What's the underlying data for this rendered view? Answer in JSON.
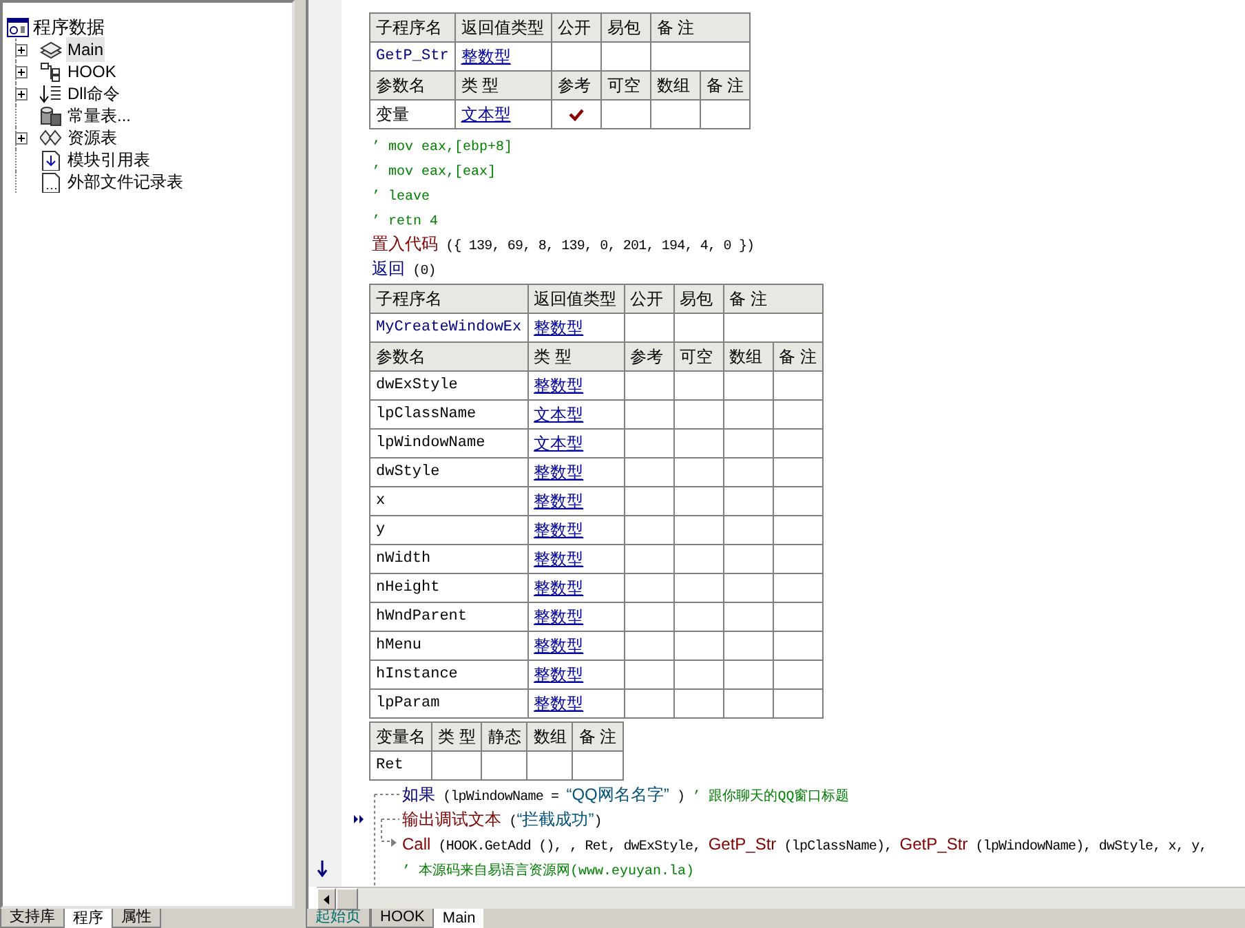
{
  "tree": {
    "label": "程序数据",
    "children": [
      {
        "label": "Main",
        "expandable": true,
        "selected": true
      },
      {
        "label": "HOOK",
        "expandable": true,
        "selected": false
      },
      {
        "label": "Dll命令",
        "expandable": true,
        "selected": false
      },
      {
        "label": "常量表...",
        "expandable": false,
        "selected": false
      },
      {
        "label": "资源表",
        "expandable": true,
        "selected": false
      },
      {
        "label": "模块引用表",
        "expandable": false,
        "selected": false
      },
      {
        "label": "外部文件记录表",
        "expandable": false,
        "selected": false
      }
    ]
  },
  "left_tabs": [
    {
      "label": "支持库",
      "selected": false
    },
    {
      "label": "程序",
      "selected": true
    },
    {
      "label": "属性",
      "selected": false
    }
  ],
  "blocks": [
    {
      "kind": "sub",
      "header": [
        "子程序名",
        "返回值类型",
        "公开",
        "易包",
        "备 注"
      ],
      "name": "GetP_Str",
      "return_type": "整数型",
      "param_header": [
        "参数名",
        "类 型",
        "参考",
        "可空",
        "数组",
        "备 注"
      ],
      "params": [
        {
          "name": "变量",
          "type": "文本型",
          "reference": true
        }
      ]
    },
    {
      "kind": "code",
      "segments": [
        {
          "kind": "comment",
          "text": "’ mov eax,[ebp+8]"
        }
      ]
    },
    {
      "kind": "code",
      "segments": [
        {
          "kind": "comment",
          "text": "’ mov eax,[eax]"
        }
      ]
    },
    {
      "kind": "code",
      "segments": [
        {
          "kind": "comment",
          "text": "’ leave"
        }
      ]
    },
    {
      "kind": "code",
      "segments": [
        {
          "kind": "comment",
          "text": "’ retn 4"
        }
      ]
    },
    {
      "kind": "code",
      "segments": [
        {
          "kind": "cmd",
          "text": "置入代码"
        },
        {
          "kind": "plain",
          "text": " ({ 139, 69, 8, 139, 0, 201, 194, 4, 0 })"
        }
      ]
    },
    {
      "kind": "code",
      "segments": [
        {
          "kind": "flow",
          "text": "返回"
        },
        {
          "kind": "plain",
          "text": " (0)"
        }
      ]
    },
    {
      "kind": "sub",
      "header": [
        "子程序名",
        "返回值类型",
        "公开",
        "易包",
        "备 注"
      ],
      "name": "MyCreateWindowEx",
      "return_type": "整数型",
      "param_header": [
        "参数名",
        "类 型",
        "参考",
        "可空",
        "数组",
        "备 注"
      ],
      "params": [
        {
          "name": "dwExStyle",
          "type": "整数型",
          "reference": false
        },
        {
          "name": "lpClassName",
          "type": "文本型",
          "reference": false
        },
        {
          "name": "lpWindowName",
          "type": "文本型",
          "reference": false
        },
        {
          "name": "dwStyle",
          "type": "整数型",
          "reference": false
        },
        {
          "name": "x",
          "type": "整数型",
          "reference": false
        },
        {
          "name": "y",
          "type": "整数型",
          "reference": false
        },
        {
          "name": "nWidth",
          "type": "整数型",
          "reference": false
        },
        {
          "name": "nHeight",
          "type": "整数型",
          "reference": false
        },
        {
          "name": "hWndParent",
          "type": "整数型",
          "reference": false
        },
        {
          "name": "hMenu",
          "type": "整数型",
          "reference": false
        },
        {
          "name": "hInstance",
          "type": "整数型",
          "reference": false
        },
        {
          "name": "lpParam",
          "type": "整数型",
          "reference": false
        }
      ]
    },
    {
      "kind": "vars",
      "header": [
        "变量名",
        "类 型",
        "静态",
        "数组",
        "备 注"
      ],
      "rows": [
        {
          "name": "Ret"
        }
      ]
    },
    {
      "kind": "flowblock",
      "lines": [
        {
          "segments": [
            {
              "kind": "flow",
              "text": "如果"
            },
            {
              "kind": "plain",
              "text": " (lpWindowName = "
            },
            {
              "kind": "string",
              "text": "“QQ网名名字”"
            },
            {
              "kind": "plain",
              "text": " ) "
            },
            {
              "kind": "comment",
              "text": "’ 跟你聊天的QQ窗口标题"
            }
          ]
        },
        {
          "segments": [
            {
              "kind": "cmd",
              "text": "输出调试文本"
            },
            {
              "kind": "plain",
              "text": " ("
            },
            {
              "kind": "string",
              "text": "“拦截成功”"
            },
            {
              "kind": "plain",
              "text": ")"
            }
          ]
        },
        {
          "segments": [
            {
              "kind": "cmd",
              "text": "Call"
            },
            {
              "kind": "plain",
              "text": " (HOOK.GetAdd (), , Ret, dwExStyle, "
            },
            {
              "kind": "cmd",
              "text": "GetP_Str"
            },
            {
              "kind": "plain",
              "text": " (lpClassName), "
            },
            {
              "kind": "cmd",
              "text": "GetP_Str"
            },
            {
              "kind": "plain",
              "text": " (lpWindowName), dwStyle, x, y,"
            }
          ]
        },
        {
          "segments": [
            {
              "kind": "comment",
              "text": "’ 本源码来自易语言资源网(www.eyuyan.la)"
            }
          ]
        }
      ]
    }
  ],
  "right_tabs": [
    {
      "label": "起始页",
      "selected": false
    },
    {
      "label": "HOOK",
      "selected": false
    },
    {
      "label": "Main",
      "selected": true
    }
  ]
}
